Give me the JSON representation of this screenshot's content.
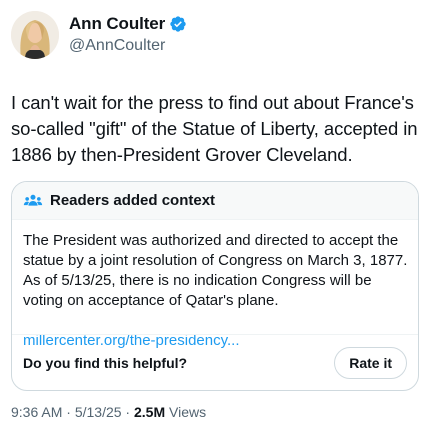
{
  "author": {
    "name": "Ann Coulter",
    "handle": "@AnnCoulter",
    "verified": true
  },
  "tweet": {
    "text": "I can't wait for the press to find out about France's so-called \"gift\" of the Statue of Liberty, accepted in 1886 by then-President Grover Cleveland."
  },
  "note": {
    "title": "Readers added context",
    "body": "The President was authorized and directed to accept the statue by a joint resolution of Congress on March 3, 1877. As of 5/13/25, there is no indication Congress will be voting on acceptance of Qatar's plane.",
    "link": "millercenter.org/the-presidency...",
    "helpful_question": "Do you find this helpful?",
    "rate_label": "Rate it"
  },
  "meta": {
    "time": "9:36 AM",
    "sep1": " · ",
    "date": "5/13/25",
    "sep2": " · ",
    "views_count": "2.5M",
    "views_label": " Views"
  },
  "colors": {
    "accent": "#1d9bf0",
    "text": "#0f1419",
    "secondary": "#536471",
    "border": "#cfd9de"
  },
  "icons": {
    "verified": "verified-badge-icon",
    "note_header": "people-icon"
  }
}
